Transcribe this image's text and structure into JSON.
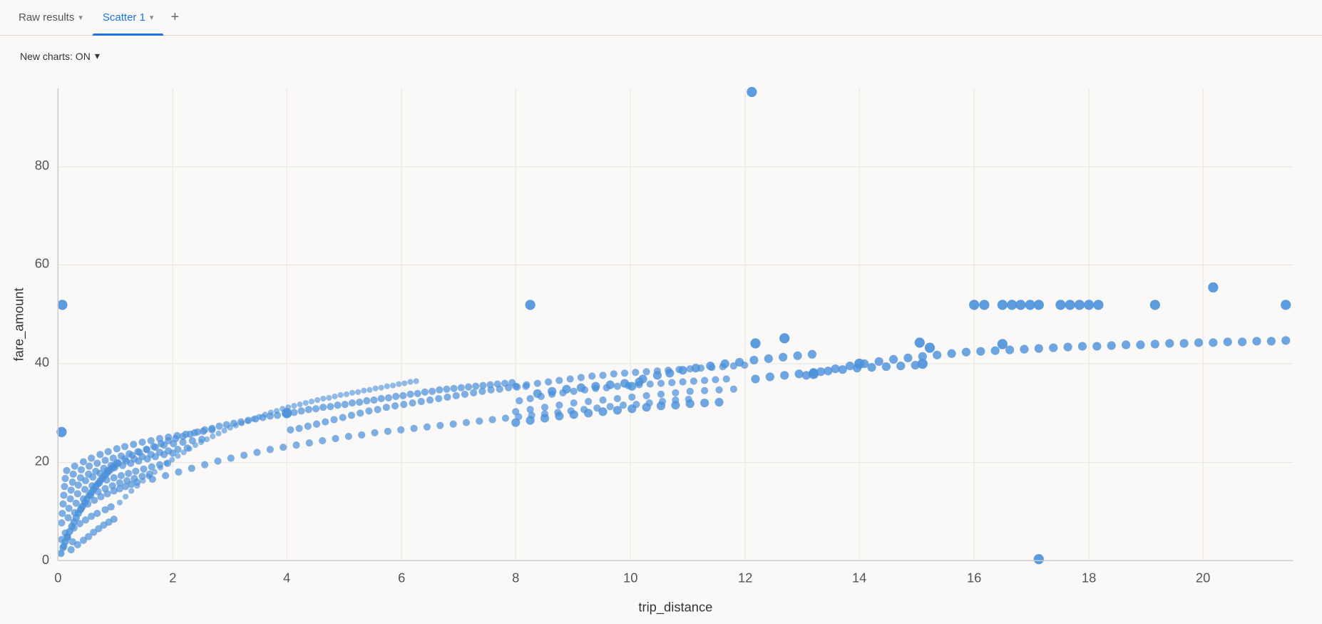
{
  "tabs": [
    {
      "id": "raw-results",
      "label": "Raw results",
      "active": false
    },
    {
      "id": "scatter-1",
      "label": "Scatter 1",
      "active": true
    }
  ],
  "tab_add_label": "+",
  "new_charts": {
    "label": "New charts: ON",
    "chevron": "▾"
  },
  "chart": {
    "x_axis_label": "trip_distance",
    "y_axis_label": "fare_amount",
    "x_ticks": [
      "0",
      "2",
      "4",
      "6",
      "8",
      "10",
      "12",
      "14",
      "16",
      "18",
      "20"
    ],
    "y_ticks": [
      "0",
      "20",
      "40",
      "60",
      "80"
    ],
    "dot_color": "#4a90d9",
    "background": "#faf9f7",
    "grid_color": "#e8e5e0"
  }
}
